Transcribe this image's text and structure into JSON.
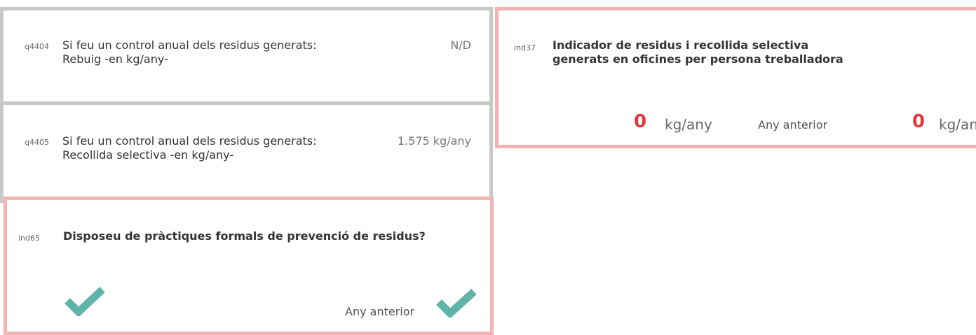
{
  "questions": [
    {
      "id": "q4404",
      "line1": "Si feu un control anual dels residus generats:",
      "line2": "Rebuig -en kg/any-",
      "value": "N/D"
    },
    {
      "id": "q4405",
      "line1": "Si feu un control anual dels residus generats:",
      "line2": "Recollida selectiva -en kg/any-",
      "value": "1.575 kg/any"
    }
  ],
  "indicator_prevention": {
    "id": "ind65",
    "title": "Disposeu de pràctiques formals de prevenció de residus?",
    "current": "yes",
    "previous_label": "Any anterior",
    "previous": "yes",
    "check_icon": "check-icon",
    "check_color": "#5fb3a8"
  },
  "indicator_waste": {
    "id": "ind37",
    "title_line1": "Indicador de residus i recollida selectiva",
    "title_line2": "generats en oficines per persona treballadora",
    "current_value": "0",
    "current_unit": "kg/any",
    "previous_label": "Any anterior",
    "previous_value": "0",
    "previous_unit": "kg/any",
    "value_color": "#e0393e"
  },
  "colors": {
    "grey_border": "#c8c8c8",
    "pink_border": "#f2b3b3"
  }
}
